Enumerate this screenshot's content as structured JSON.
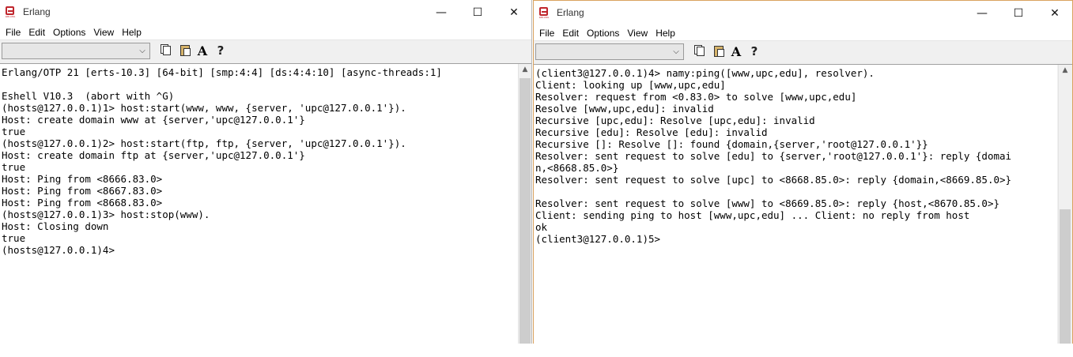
{
  "app_icon_text": "ERLANG",
  "left_window": {
    "title": "Erlang",
    "menu": [
      "File",
      "Edit",
      "Options",
      "View",
      "Help"
    ],
    "caption": {
      "minimize": "—",
      "maximize": "☐",
      "close": "✕"
    },
    "toolbar": {
      "combo_value": "",
      "combo_arrow": "⌵",
      "font_icon": "A",
      "help_icon": "?"
    },
    "console_lines": [
      "Erlang/OTP 21 [erts-10.3] [64-bit] [smp:4:4] [ds:4:4:10] [async-threads:1]",
      "",
      "Eshell V10.3  (abort with ^G)",
      "(hosts@127.0.0.1)1> host:start(www, www, {server, 'upc@127.0.0.1'}).",
      "Host: create domain www at {server,'upc@127.0.0.1'}",
      "true",
      "(hosts@127.0.0.1)2> host:start(ftp, ftp, {server, 'upc@127.0.0.1'}).",
      "Host: create domain ftp at {server,'upc@127.0.0.1'}",
      "true",
      "Host: Ping from <8666.83.0>",
      "Host: Ping from <8667.83.0>",
      "Host: Ping from <8668.83.0>",
      "(hosts@127.0.0.1)3> host:stop(www).",
      "Host: Closing down",
      "true",
      "(hosts@127.0.0.1)4>"
    ]
  },
  "right_window": {
    "title": "Erlang",
    "menu": [
      "File",
      "Edit",
      "Options",
      "View",
      "Help"
    ],
    "caption": {
      "minimize": "—",
      "maximize": "☐",
      "close": "✕"
    },
    "toolbar": {
      "combo_value": "",
      "combo_arrow": "⌵",
      "font_icon": "A",
      "help_icon": "?"
    },
    "console_lines": [
      "(client3@127.0.0.1)4> namy:ping([www,upc,edu], resolver).",
      "Client: looking up [www,upc,edu]",
      "Resolver: request from <0.83.0> to solve [www,upc,edu]",
      "Resolve [www,upc,edu]: invalid",
      "Recursive [upc,edu]: Resolve [upc,edu]: invalid",
      "Recursive [edu]: Resolve [edu]: invalid",
      "Recursive []: Resolve []: found {domain,{server,'root@127.0.0.1'}}",
      "Resolver: sent request to solve [edu] to {server,'root@127.0.0.1'}: reply {domai",
      "n,<8668.85.0>}",
      "Resolver: sent request to solve [upc] to <8668.85.0>: reply {domain,<8669.85.0>}",
      "",
      "Resolver: sent request to solve [www] to <8669.85.0>: reply {host,<8670.85.0>}",
      "Client: sending ping to host [www,upc,edu] ... Client: no reply from host",
      "ok",
      "(client3@127.0.0.1)5>"
    ]
  }
}
